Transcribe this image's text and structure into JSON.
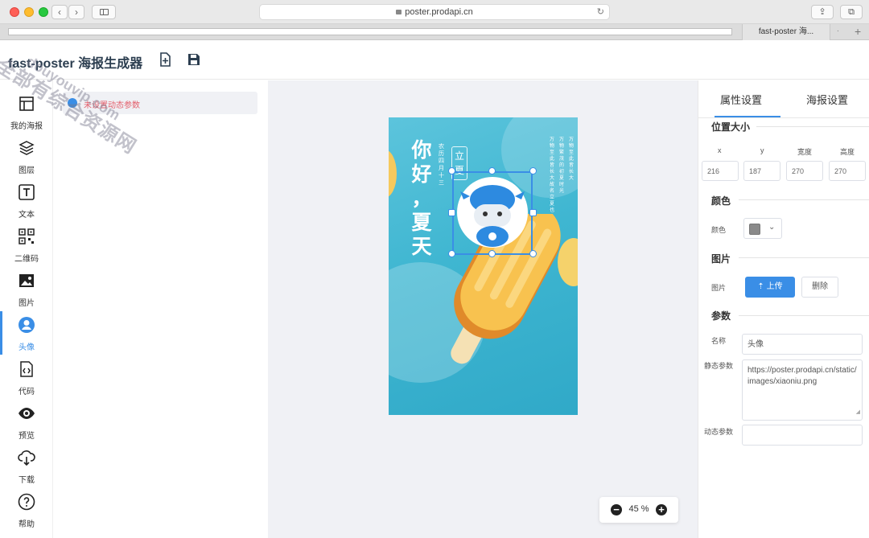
{
  "browser": {
    "url": "poster.prodapi.cn",
    "active_tab": "fast-poster 海...",
    "tab_more": "."
  },
  "header": {
    "title": "fast-poster 海报生成器"
  },
  "nav": [
    {
      "label": "我的海报",
      "icon": "layout-icon"
    },
    {
      "label": "图层",
      "icon": "layers-icon"
    },
    {
      "label": "文本",
      "icon": "text-icon"
    },
    {
      "label": "二维码",
      "icon": "qrcode-icon"
    },
    {
      "label": "图片",
      "icon": "image-icon"
    },
    {
      "label": "头像",
      "icon": "avatar-icon",
      "active": true
    },
    {
      "label": "代码",
      "icon": "code-icon"
    },
    {
      "label": "预览",
      "icon": "eye-icon"
    },
    {
      "label": "下载",
      "icon": "download-icon"
    },
    {
      "label": "帮助",
      "icon": "help-icon"
    }
  ],
  "layers": {
    "row_text": "未设置动态参数"
  },
  "poster": {
    "title_chars": [
      "你",
      "好",
      "，",
      "夏",
      "天"
    ],
    "sub_chars": [
      "农",
      "历",
      "四",
      "月",
      "十",
      "三"
    ],
    "box_chars": [
      "立",
      "夏"
    ],
    "vert_col1": "万物至此皆长大故名立夏也",
    "vert_col2": "万物繁茂的初夏时光",
    "vert_col3": "万物至此皆长大"
  },
  "zoom": {
    "minus": "−",
    "value": "45 %",
    "plus": "+"
  },
  "panel": {
    "tab_props": "属性设置",
    "tab_poster": "海报设置",
    "section_position": "位置大小",
    "labels": {
      "x": "x",
      "y": "y",
      "width": "宽度",
      "height": "高度"
    },
    "values": {
      "x": "216",
      "y": "187",
      "width": "270",
      "height": "270"
    },
    "section_color": "颜色",
    "color_label": "颜色",
    "color_value": "#8a8a8a",
    "section_image": "图片",
    "image_label": "图片",
    "upload_label": "上传",
    "delete_label": "删除",
    "section_params": "参数",
    "name_label": "名称",
    "name_value": "头像",
    "static_label": "静态参数",
    "static_value": "https://poster.prodapi.cn/static/images/xiaoniu.png",
    "dynamic_label": "动态参数",
    "dynamic_value": ""
  },
  "watermark": {
    "line1": "全部有综合资源网",
    "line2": "douyouvip.com"
  },
  "colors": {
    "accent": "#3a8ee6",
    "poster_bg": "#3fb6d1"
  }
}
